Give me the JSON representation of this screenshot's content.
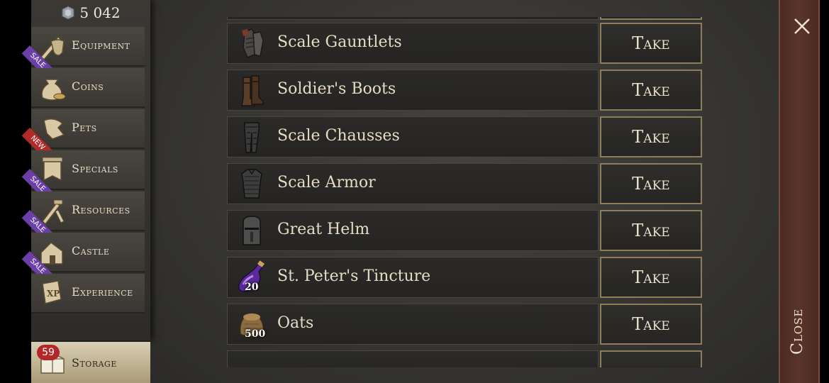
{
  "currency": {
    "amount": "5 042",
    "icon": "silver-gem-icon"
  },
  "sidebar": {
    "items": [
      {
        "label": "Equipment",
        "icon": "sword-shield-icon",
        "badge": "SALE"
      },
      {
        "label": "Coins",
        "icon": "coin-bag-icon",
        "badge": ""
      },
      {
        "label": "Pets",
        "icon": "pet-icon",
        "badge": "NEW"
      },
      {
        "label": "Specials",
        "icon": "special-banner-icon",
        "badge": "SALE"
      },
      {
        "label": "Resources",
        "icon": "tools-icon",
        "badge": "SALE"
      },
      {
        "label": "Castle",
        "icon": "castle-icon",
        "badge": "SALE"
      },
      {
        "label": "Experience",
        "icon": "xp-book-icon",
        "badge": ""
      }
    ],
    "storage": {
      "label": "Storage",
      "count": "59",
      "icon": "chest-icon"
    }
  },
  "items": [
    {
      "name": "Scale Gauntlets",
      "qty": "",
      "icon": "gauntlets-icon",
      "button": "Take"
    },
    {
      "name": "Soldier's Boots",
      "qty": "",
      "icon": "boots-icon",
      "button": "Take"
    },
    {
      "name": "Scale Chausses",
      "qty": "",
      "icon": "chausses-icon",
      "button": "Take"
    },
    {
      "name": "Scale Armor",
      "qty": "",
      "icon": "armor-icon",
      "button": "Take"
    },
    {
      "name": "Great Helm",
      "qty": "",
      "icon": "helm-icon",
      "button": "Take"
    },
    {
      "name": "St. Peter's Tincture",
      "qty": "20",
      "icon": "potion-icon",
      "button": "Take"
    },
    {
      "name": "Oats",
      "qty": "500",
      "icon": "oats-sack-icon",
      "button": "Take"
    }
  ],
  "close": {
    "label": "Close"
  },
  "colors": {
    "sale": "#6b3fa8",
    "new": "#b02a2a",
    "badge": "#b3262a",
    "button_border": "#8c7d5c"
  }
}
